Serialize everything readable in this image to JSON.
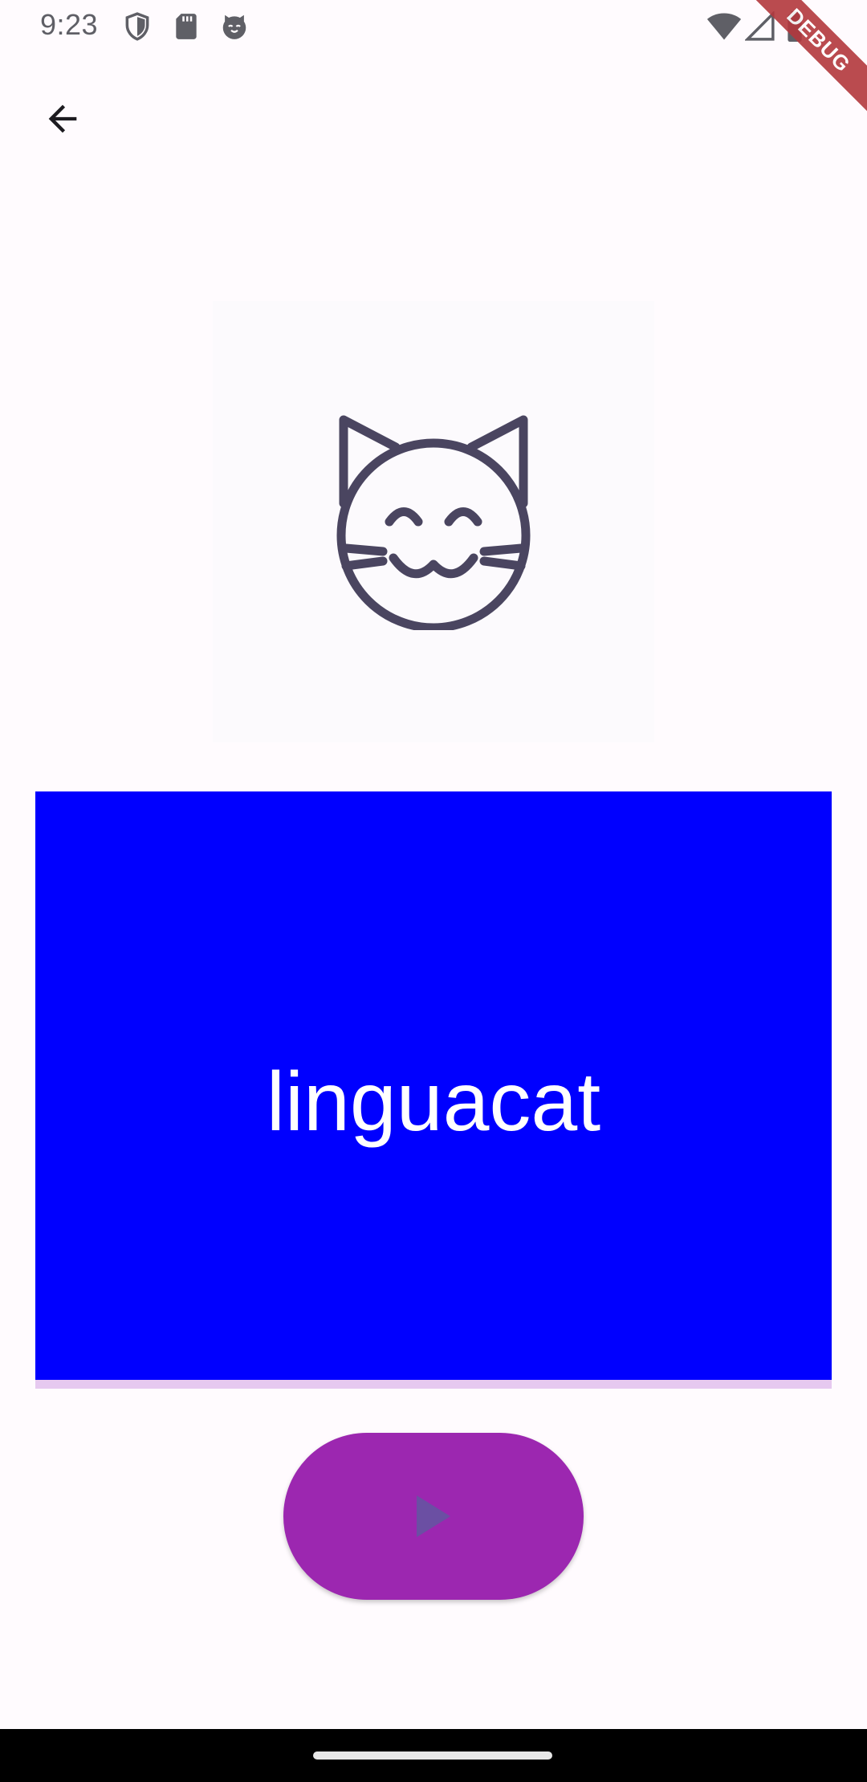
{
  "status_bar": {
    "time": "9:23",
    "left_icons": [
      "shield-icon",
      "sd-card-icon",
      "cat-notification-icon"
    ],
    "right_icons": [
      "wifi-icon",
      "signal-icon",
      "battery-icon"
    ]
  },
  "debug_banner": {
    "label": "DEBUG"
  },
  "app_bar": {
    "back_icon": "arrow-back-icon"
  },
  "flashcard": {
    "image_icon": "cat-face-icon",
    "word": "linguacat",
    "card_color": "#0000ff",
    "progress_color": "#e6c9f0"
  },
  "play_button": {
    "icon": "play-icon",
    "background": "#9c27b0",
    "icon_color": "#6b4fa3"
  },
  "colors": {
    "background": "#fffbfe",
    "icon_dark": "#4a4560"
  }
}
